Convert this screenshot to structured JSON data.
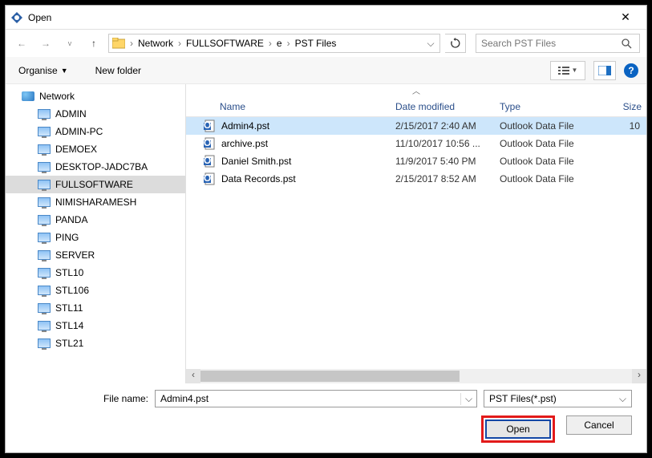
{
  "title": "Open",
  "breadcrumb": [
    "Network",
    "FULLSOFTWARE",
    "e",
    "PST Files"
  ],
  "search_placeholder": "Search PST Files",
  "toolbar": {
    "organise": "Organise",
    "newfolder": "New folder"
  },
  "tree": {
    "root": "Network",
    "items": [
      "ADMIN",
      "ADMIN-PC",
      "DEMOEX",
      "DESKTOP-JADC7BA",
      "FULLSOFTWARE",
      "NIMISHARAMESH",
      "PANDA",
      "PING",
      "SERVER",
      "STL10",
      "STL106",
      "STL11",
      "STL14",
      "STL21"
    ],
    "selected": "FULLSOFTWARE"
  },
  "columns": {
    "name": "Name",
    "date": "Date modified",
    "type": "Type",
    "size": "Size"
  },
  "files": [
    {
      "name": "Admin4.pst",
      "date": "2/15/2017 2:40 AM",
      "type": "Outlook Data File",
      "size": "10",
      "selected": true
    },
    {
      "name": "archive.pst",
      "date": "11/10/2017 10:56 ...",
      "type": "Outlook Data File",
      "size": ""
    },
    {
      "name": "Daniel Smith.pst",
      "date": "11/9/2017 5:40 PM",
      "type": "Outlook Data File",
      "size": ""
    },
    {
      "name": "Data Records.pst",
      "date": "2/15/2017 8:52 AM",
      "type": "Outlook Data File",
      "size": ""
    }
  ],
  "footer": {
    "filename_label": "File name:",
    "filename_value": "Admin4.pst",
    "filter": "PST Files(*.pst)",
    "open": "Open",
    "cancel": "Cancel"
  }
}
